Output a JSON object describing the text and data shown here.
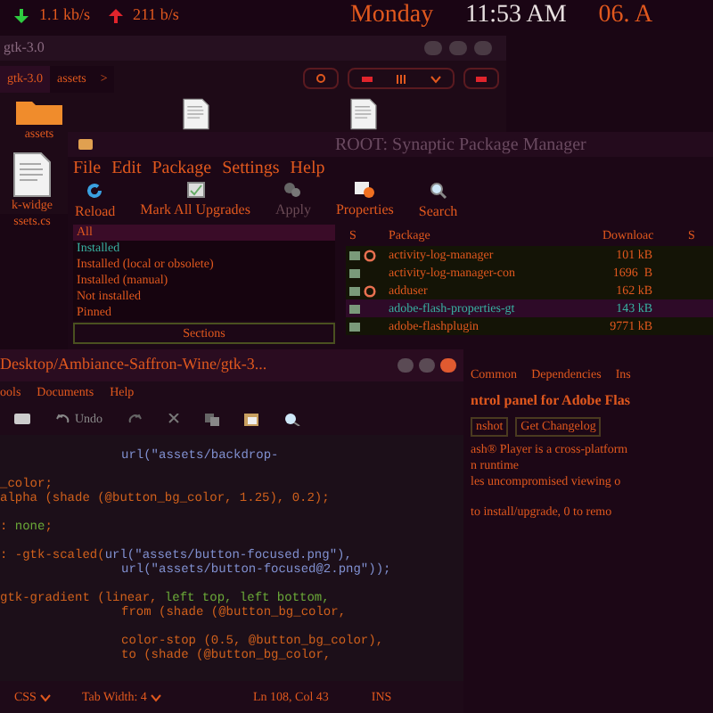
{
  "top_panel": {
    "download": "1.1 kb/s",
    "upload": "211 b/s",
    "day": "Monday",
    "time": "11:53 AM",
    "date": "06. A"
  },
  "file_manager": {
    "title": "gtk-3.0",
    "breadcrumb": [
      {
        "label": "gtk-3.0",
        "selected": true
      },
      {
        "label": "assets",
        "selected": false
      },
      {
        "label": ">",
        "selected": false
      }
    ],
    "files": [
      {
        "kind": "folder",
        "name": "assets"
      },
      {
        "kind": "file"
      },
      {
        "kind": "file"
      },
      {
        "kind": "file",
        "name": "k-widge ssets.cs"
      }
    ]
  },
  "synaptic": {
    "title": "ROOT: Synaptic Package Manager",
    "menu": [
      "File",
      "Edit",
      "Package",
      "Settings",
      "Help"
    ],
    "toolbar": [
      {
        "kind": "reload",
        "label": "Reload",
        "disabled": false
      },
      {
        "kind": "mark",
        "label": "Mark All Upgrades",
        "disabled": false
      },
      {
        "kind": "apply",
        "label": "Apply",
        "disabled": true
      },
      {
        "kind": "properties",
        "label": "Properties",
        "disabled": false
      },
      {
        "kind": "search",
        "label": "Search",
        "disabled": false
      }
    ],
    "filters": [
      {
        "label": "All",
        "selected": true,
        "installed": false
      },
      {
        "label": "Installed",
        "selected": false,
        "installed": true
      },
      {
        "label": "Installed (local or obsolete)",
        "selected": false,
        "installed": false
      },
      {
        "label": "Installed (manual)",
        "selected": false,
        "installed": false
      },
      {
        "label": "Not installed",
        "selected": false,
        "installed": false
      },
      {
        "label": "Pinned",
        "selected": false,
        "installed": false
      }
    ],
    "sections_button": "Sections",
    "columns": [
      "S",
      "Package",
      "Downloac",
      "S"
    ],
    "rows": [
      {
        "name": "activity-log-manager",
        "size": "101 kB",
        "supported": true,
        "selected": false
      },
      {
        "name": "activity-log-manager-con",
        "size": "1696  B",
        "supported": false,
        "selected": false
      },
      {
        "name": "adduser",
        "size": "162 kB",
        "supported": true,
        "selected": false
      },
      {
        "name": "adobe-flash-properties-gt",
        "size": "143 kB",
        "supported": false,
        "selected": true
      },
      {
        "name": "adobe-flashplugin",
        "size": "9771 kB",
        "supported": false,
        "selected": false
      }
    ],
    "detail_tabs": [
      "Common",
      "Dependencies",
      "Ins"
    ],
    "heading": "ntrol panel for Adobe Flas",
    "buttons": [
      "nshot",
      "Get Changelog"
    ],
    "description": [
      "ash® Player is a cross-platform",
      "n runtime",
      "les uncompromised viewing o"
    ],
    "status": "to install/upgrade, 0 to remo"
  },
  "gedit": {
    "title": "Desktop/Ambiance-Saffron-Wine/gtk-3...",
    "menu": [
      "ools",
      "Documents",
      "Help"
    ],
    "undo": "Undo",
    "lines": [
      {
        "kind": "indented",
        "parts": [
          {
            "kind": "string",
            "text": "url(\"assets/backdrop-"
          }
        ]
      },
      {
        "kind": "plain"
      },
      {
        "kind": "plain",
        "parts": [
          {
            "kind": "code",
            "text": "_color;"
          }
        ]
      },
      {
        "kind": "plain",
        "parts": [
          {
            "kind": "code",
            "text": "alpha (shade (@button_bg_color, 1.25), 0.2);"
          }
        ]
      },
      {
        "kind": "plain"
      },
      {
        "kind": "plain",
        "parts": [
          {
            "kind": "code",
            "text": ": "
          },
          {
            "kind": "keyword",
            "text": "none"
          },
          {
            "kind": "code",
            "text": ";"
          }
        ]
      },
      {
        "kind": "plain"
      },
      {
        "kind": "plain",
        "parts": [
          {
            "kind": "code",
            "text": ": -gtk-scaled("
          },
          {
            "kind": "string",
            "text": "url(\"assets/button-focused.png\"),"
          }
        ]
      },
      {
        "kind": "indented",
        "parts": [
          {
            "kind": "string",
            "text": "url(\"assets/button-focused@2.png\"));"
          }
        ]
      },
      {
        "kind": "plain"
      },
      {
        "kind": "plain",
        "parts": [
          {
            "kind": "code",
            "text": "gtk-gradient (linear, "
          },
          {
            "kind": "keyword",
            "text": "left top, left bottom,"
          }
        ]
      },
      {
        "kind": "indented",
        "parts": [
          {
            "kind": "code",
            "text": "from (shade (@button_bg_color,"
          }
        ]
      },
      {
        "kind": "plain"
      },
      {
        "kind": "indented",
        "parts": [
          {
            "kind": "code",
            "text": "color-stop (0.5, @button_bg_color),"
          }
        ]
      },
      {
        "kind": "indented",
        "parts": [
          {
            "kind": "code",
            "text": "to (shade (@button_bg_color,"
          }
        ]
      }
    ],
    "status": {
      "language": "CSS",
      "tab_width": "Tab Width: 4",
      "position": "Ln 108, Col 43",
      "mode": "INS"
    }
  }
}
